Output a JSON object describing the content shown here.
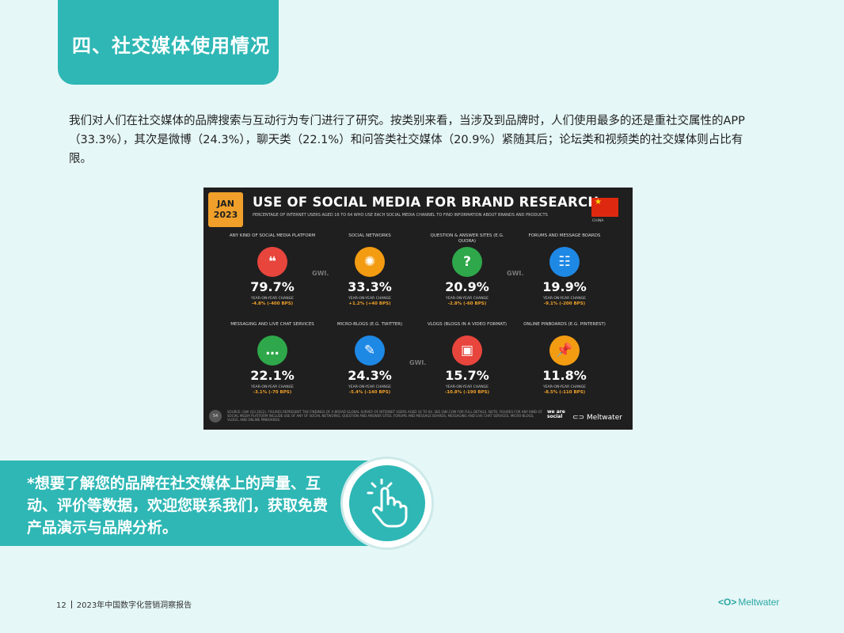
{
  "header": {
    "title": "四、社交媒体使用情况"
  },
  "intro": "我们对人们在社交媒体的品牌搜索与互动行为专门进行了研究。按类别来看，当涉及到品牌时，人们使用最多的还是重社交属性的APP（33.3%），其次是微博（24.3%），聊天类（22.1%）和问答类社交媒体（20.9%）紧随其后；论坛类和视频类的社交媒体则占比有限。",
  "infographic": {
    "badge_month": "JAN",
    "badge_year": "2023",
    "title": "USE OF SOCIAL MEDIA FOR BRAND RESEARCH",
    "subtitle": "PERCENTAGE OF INTERNET USERS AGED 16 TO 64 WHO USE EACH SOCIAL MEDIA CHANNEL TO FIND INFORMATION ABOUT BRANDS AND PRODUCTS",
    "flag_label": "CHINA",
    "change_label": "YEAR-ON-YEAR CHANGE",
    "tiles": [
      {
        "label": "ANY KIND OF SOCIAL MEDIA PLATFORM",
        "value": "79.7%",
        "change": "-4.8% (-400 BPS)",
        "color": "#e8453c",
        "icon": "chat-bubble-icon",
        "glyph": "❝"
      },
      {
        "label": "SOCIAL NETWORKS",
        "value": "33.3%",
        "change": "+1.2% (+40 BPS)",
        "color": "#f39c12",
        "icon": "network-icon",
        "glyph": "✺"
      },
      {
        "label": "QUESTION & ANSWER SITES (E.G. QUORA)",
        "value": "20.9%",
        "change": "-2.8% (-60 BPS)",
        "color": "#2ea84a",
        "icon": "question-icon",
        "glyph": "?"
      },
      {
        "label": "FORUMS AND MESSAGE BOARDS",
        "value": "19.9%",
        "change": "-9.1% (-200 BPS)",
        "color": "#1e88e5",
        "icon": "forum-icon",
        "glyph": "☷"
      },
      {
        "label": "MESSAGING AND LIVE CHAT SERVICES",
        "value": "22.1%",
        "change": "-3.1% (-70 BPS)",
        "color": "#2ea84a",
        "icon": "messaging-icon",
        "glyph": "…"
      },
      {
        "label": "MICRO-BLOGS (E.G. TWITTER)",
        "value": "24.3%",
        "change": "-5.4% (-140 BPS)",
        "color": "#1e88e5",
        "icon": "edit-icon",
        "glyph": "✎"
      },
      {
        "label": "VLOGS (BLOGS IN A VIDEO FORMAT)",
        "value": "15.7%",
        "change": "-10.8% (-190 BPS)",
        "color": "#e8453c",
        "icon": "video-icon",
        "glyph": "▣"
      },
      {
        "label": "ONLINE PINBOARDS (E.G. PINTEREST)",
        "value": "11.8%",
        "change": "-8.5% (-110 BPS)",
        "color": "#f39c12",
        "icon": "pin-icon",
        "glyph": "📌"
      }
    ],
    "watermark": "GWI.",
    "source": "SOURCE: GWI (Q3 2022). FIGURES REPRESENT THE FINDINGS OF A BROAD GLOBAL SURVEY OF INTERNET USERS AGED 16 TO 64. SEE GWI.COM FOR FULL DETAILS. NOTE: FIGURES FOR ANY KIND OF SOCIAL MEDIA PLATFORM INCLUDE USE OF ANY OF SOCIAL NETWORKS, QUESTION AND ANSWER SITES, FORUMS AND MESSAGE BOARDS, MESSAGING AND LIVE CHAT SERVICES, MICRO-BLOGS, VLOGS, AND ONLINE PINBOARDS.",
    "page_no": "54",
    "was_logo": "we are social",
    "meltwater": "Meltwater"
  },
  "cta": {
    "text": "*想要了解您的品牌在社交媒体上的声量、互动、评价等数据，欢迎您联系我们，获取免费产品演示与品牌分析。"
  },
  "footer": {
    "page": "12",
    "report": "2023年中国数字化营销洞察报告",
    "logo_mark": "<O>",
    "logo_text": "Meltwater"
  }
}
